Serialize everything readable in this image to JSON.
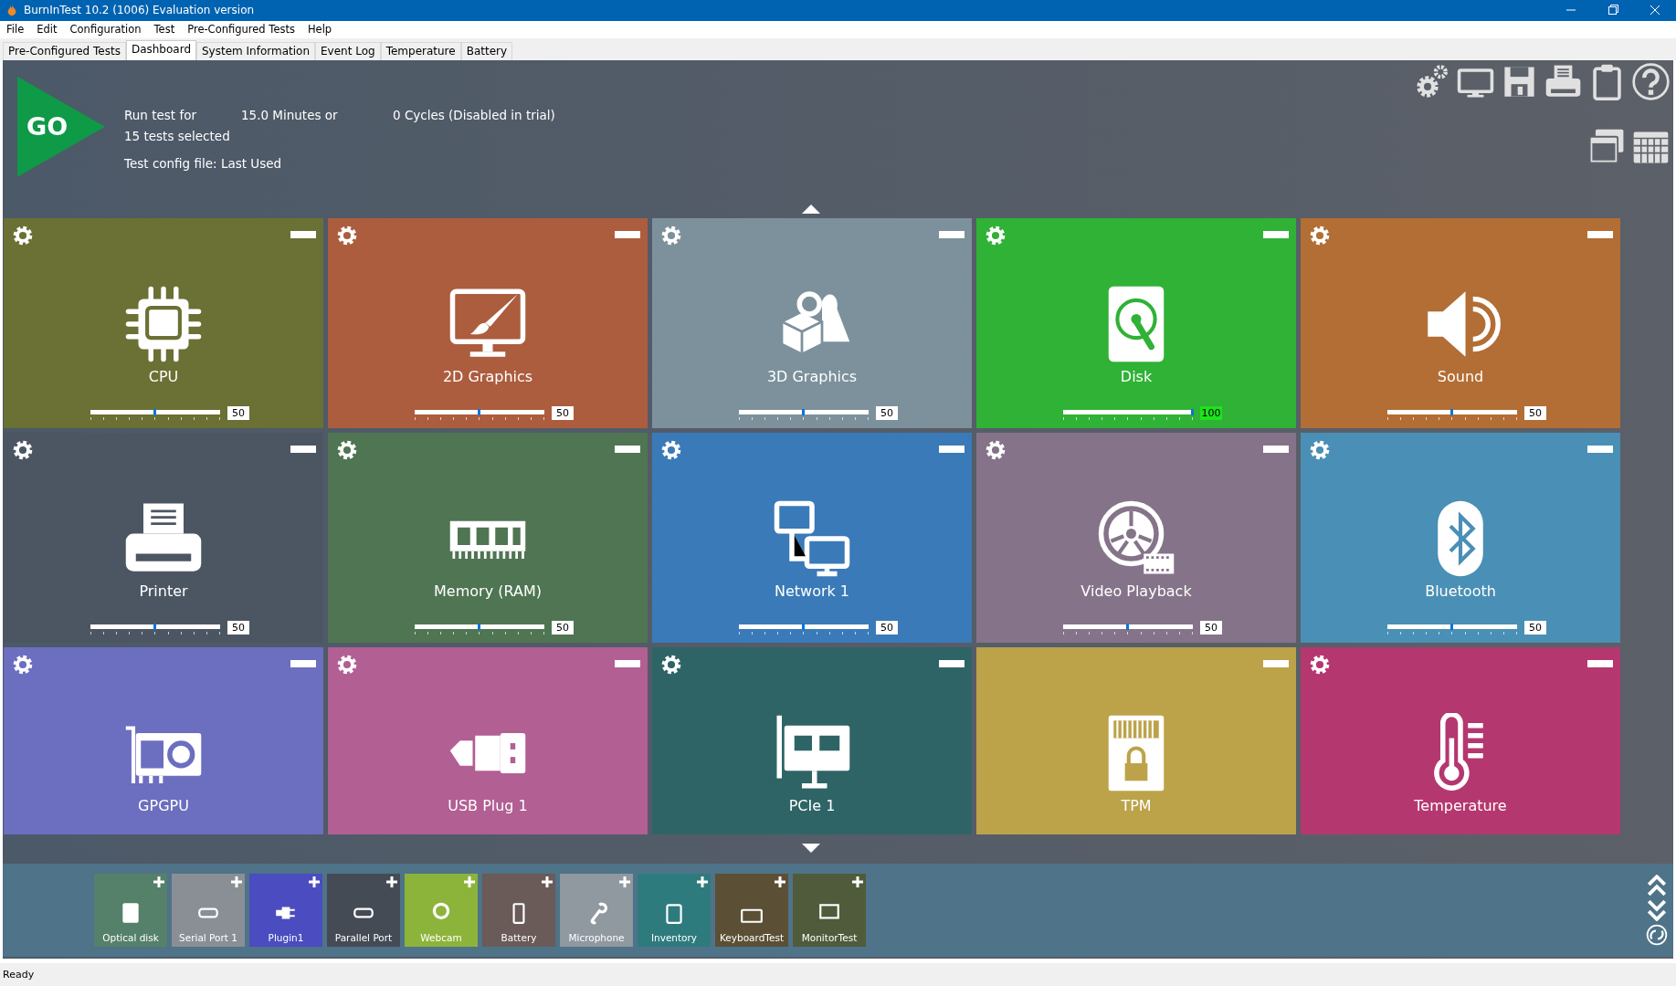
{
  "window": {
    "title": "BurnInTest 10.2 (1006) Evaluation version"
  },
  "menu": [
    "File",
    "Edit",
    "Configuration",
    "Test",
    "Pre-Configured Tests",
    "Help"
  ],
  "tabs": [
    {
      "label": "Pre-Configured Tests",
      "selected": false
    },
    {
      "label": "Dashboard",
      "selected": true
    },
    {
      "label": "System Information",
      "selected": false
    },
    {
      "label": "Event Log",
      "selected": false
    },
    {
      "label": "Temperature",
      "selected": false
    },
    {
      "label": "Battery",
      "selected": false
    }
  ],
  "run": {
    "go": "GO",
    "run_test_for": "Run test for",
    "duration": "15.0 Minutes or",
    "cycles": "0 Cycles (Disabled in trial)",
    "tests_selected": "15 tests selected",
    "config_file": "Test config file: Last Used"
  },
  "tiles": [
    {
      "label": "CPU",
      "color": "#6b7034",
      "settings": true,
      "slider": {
        "level": 0.5,
        "value": "50",
        "highlight": false
      }
    },
    {
      "label": "2D Graphics",
      "color": "#ac5d3e",
      "settings": true,
      "slider": {
        "level": 0.5,
        "value": "50",
        "highlight": false
      }
    },
    {
      "label": "3D Graphics",
      "color": "#7c919b",
      "settings": true,
      "slider": {
        "level": 0.5,
        "value": "50",
        "highlight": false
      }
    },
    {
      "label": "Disk",
      "color": "#2fb236",
      "settings": true,
      "slider": {
        "level": 1,
        "value": "100",
        "highlight": true
      }
    },
    {
      "label": "Sound",
      "color": "#b26e35",
      "settings": true,
      "slider": {
        "level": 0.5,
        "value": "50",
        "highlight": false
      }
    },
    {
      "label": "Printer",
      "color": "#4c5663",
      "settings": true,
      "slider": {
        "level": 0.5,
        "value": "50",
        "highlight": false
      }
    },
    {
      "label": "Memory (RAM)",
      "color": "#4f7552",
      "settings": true,
      "slider": {
        "level": 0.5,
        "value": "50",
        "highlight": false
      }
    },
    {
      "label": "Network 1",
      "color": "#3a7ab8",
      "settings": true,
      "slider": {
        "level": 0.5,
        "value": "50",
        "highlight": false
      }
    },
    {
      "label": "Video Playback",
      "color": "#857489",
      "settings": true,
      "slider": {
        "level": 0.5,
        "value": "50",
        "highlight": false
      }
    },
    {
      "label": "Bluetooth",
      "color": "#4a8fb5",
      "settings": true,
      "slider": {
        "level": 0.5,
        "value": "50",
        "highlight": false
      }
    },
    {
      "label": "GPGPU",
      "color": "#6c6ec0",
      "settings": true
    },
    {
      "label": "USB Plug 1",
      "color": "#b25f94",
      "settings": true
    },
    {
      "label": "PCIe 1",
      "color": "#2f6467",
      "settings": true
    },
    {
      "label": "TPM",
      "color": "#bca34a",
      "settings": false
    },
    {
      "label": "Temperature",
      "color": "#b5376f",
      "settings": true
    }
  ],
  "available_tests": [
    {
      "label": "Optical disk",
      "color": "#55806a"
    },
    {
      "label": "Serial Port 1",
      "color": "#8a8f96"
    },
    {
      "label": "Plugin1",
      "color": "#4a4cc0"
    },
    {
      "label": "Parallel Port",
      "color": "#454b55"
    },
    {
      "label": "Webcam",
      "color": "#8db43a"
    },
    {
      "label": "Battery",
      "color": "#6a5a58"
    },
    {
      "label": "Microphone",
      "color": "#9098a0"
    },
    {
      "label": "Inventory",
      "color": "#2e7b7e"
    },
    {
      "label": "KeyboardTest",
      "color": "#5b5035"
    },
    {
      "label": "MonitorTest",
      "color": "#4f5b3a"
    }
  ],
  "status_bar": "Ready"
}
